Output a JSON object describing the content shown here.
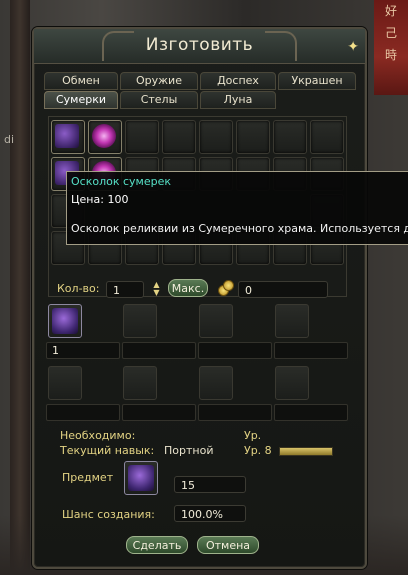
{
  "background": {
    "banner_chars": [
      "好",
      "己",
      "時"
    ],
    "left_text": "di"
  },
  "window": {
    "title": "Изготовить"
  },
  "tabs": {
    "row1": [
      "Обмен",
      "Оружие",
      "Доспех",
      "Украшен"
    ],
    "row2": [
      "Сумерки",
      "Стелы",
      "Луна"
    ],
    "active": "Сумерки"
  },
  "tooltip": {
    "name": "Осколок сумерек",
    "price": "Цена: 100",
    "description": "Осколок реликвии из Сумеречного храма. Используется для"
  },
  "quantity": {
    "label": "Кол-во:",
    "value": "1",
    "max_label": "Макс.",
    "gold_value": "0"
  },
  "materials": {
    "first_count": "1"
  },
  "info": {
    "required_label": "Необходимо:",
    "level_label": "Ур.",
    "current_skill_label": "Текущий навык:",
    "skill_name": "Портной",
    "skill_level": "Ур. 8",
    "item_label": "Предмет",
    "item_count": "15",
    "chance_label": "Шанс создания:",
    "chance_value": "100.0%"
  },
  "buttons": {
    "craft": "Сделать",
    "cancel": "Отмена"
  },
  "colors": {
    "accent_teal": "#56e0c6",
    "label_gold": "#e3d384",
    "button_green": "#4a6a45"
  }
}
